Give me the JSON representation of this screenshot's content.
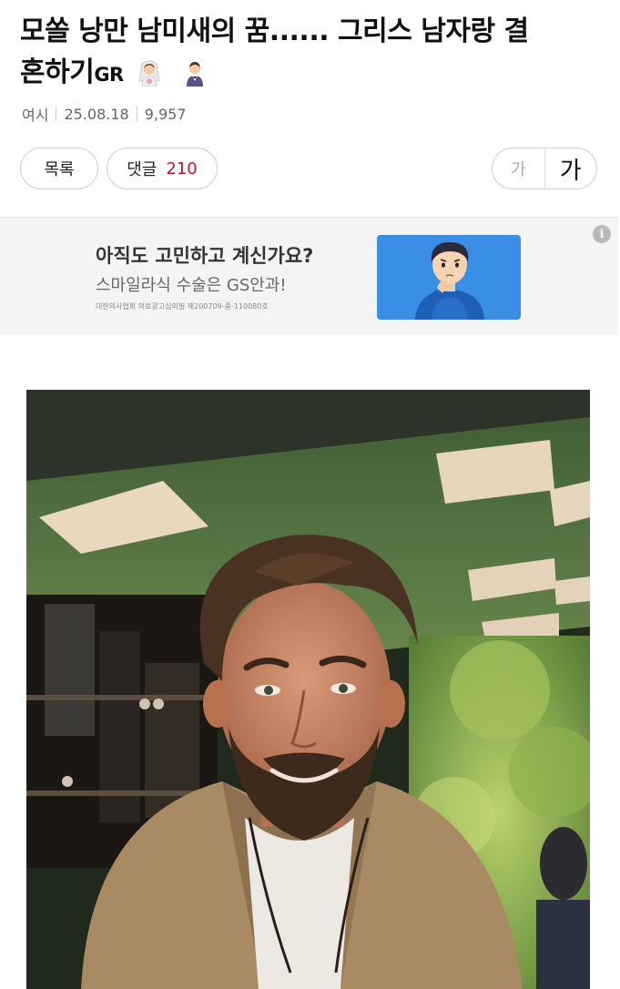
{
  "post": {
    "title_line1": "모쏠 낭만 남미새의 꿈...... 그리스 남자랑 결",
    "title_line2": "혼하기",
    "title_suffix": "GR",
    "title_emojis": [
      "bride-emoji",
      "groom-emoji"
    ],
    "author": "여시",
    "date": "25.08.18",
    "views": "9,957"
  },
  "actions": {
    "list_label": "목록",
    "comment_label": "댓글",
    "comment_count": "210",
    "font_small_label": "가",
    "font_large_label": "가"
  },
  "ad": {
    "headline": "아직도 고민하고 계신가요?",
    "subline": "스마일라식 수술은 GS안과!",
    "fine_print": "대한의사협회 의료광고심의필 제200709-중-110080호",
    "info_label": "i",
    "image_icon": "thinking-man-illustration"
  },
  "content": {
    "image_icon": "smiling-bearded-man-photo"
  },
  "colors": {
    "comment_count": "#c8102e",
    "ad_background": "#f4f4f4",
    "ad_image_bg": "#3a8ee6"
  }
}
